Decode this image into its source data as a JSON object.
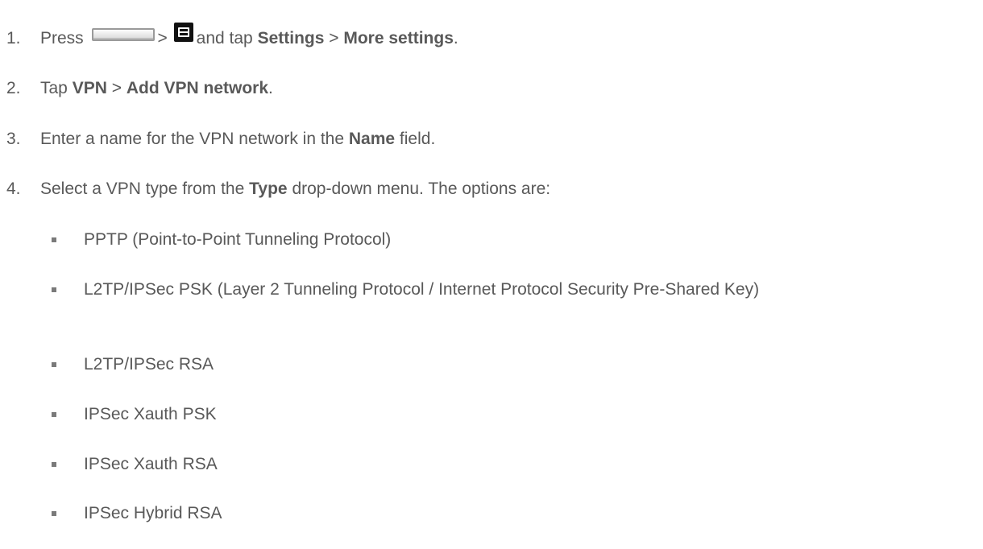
{
  "steps": [
    {
      "num": "1.",
      "press": "Press",
      "gt1": ">",
      "and_tap": "and tap",
      "settings": "Settings",
      "gt2": ">",
      "more_settings": "More settings",
      "end": ".",
      "home_key_icon": "home-key-icon",
      "menu_key_icon": "menu-key-icon"
    },
    {
      "num": "2.",
      "tap": "Tap",
      "vpn": "VPN",
      "gt": ">",
      "add_vpn": "Add VPN network",
      "end": "."
    },
    {
      "num": "3.",
      "text1": "Enter a name for the VPN network in the",
      "name": "Name",
      "text2": "field."
    },
    {
      "num": "4.",
      "text1": "Select a VPN type from the",
      "type": "Type",
      "text2": "drop-down menu. The options are:"
    }
  ],
  "options": [
    "PPTP (Point-to-Point Tunneling Protocol)",
    "L2TP/IPSec PSK (Layer 2 Tunneling Protocol / Internet Protocol Security Pre-Shared Key)",
    "L2TP/IPSec RSA",
    "IPSec Xauth PSK",
    "IPSec Xauth RSA",
    "IPSec Hybrid RSA"
  ]
}
